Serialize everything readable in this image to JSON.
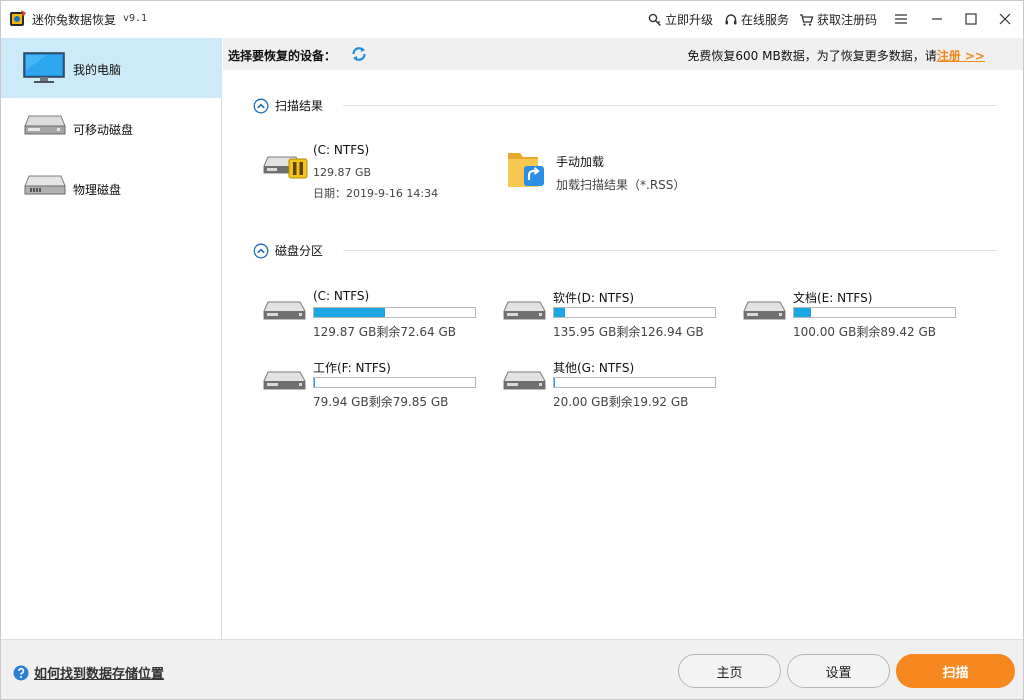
{
  "titlebar": {
    "title": "迷你兔数据恢复",
    "version": "v9.1",
    "links": {
      "upgrade": "立即升级",
      "online_service": "在线服务",
      "get_code": "获取注册码"
    }
  },
  "sidebar": {
    "items": [
      {
        "label": "我的电脑",
        "icon": "monitor-icon",
        "active": true
      },
      {
        "label": "可移动磁盘",
        "icon": "removable-disk-icon",
        "active": false
      },
      {
        "label": "物理磁盘",
        "icon": "physical-disk-icon",
        "active": false
      }
    ]
  },
  "header": {
    "select_label": "选择要恢复的设备：",
    "free_note": "免费恢复600 MB数据，为了恢复更多数据，请",
    "register_link": "注册 >>"
  },
  "scan_results": {
    "title": "扫描结果",
    "items": [
      {
        "name": "(C: NTFS)",
        "size": "129.87 GB",
        "date": "日期：2019-9-16 14:34"
      },
      {
        "name": "手动加载",
        "desc": "加载扫描结果（*.RSS）"
      }
    ]
  },
  "partitions": {
    "title": "磁盘分区",
    "items": [
      {
        "name": "(C: NTFS)",
        "usage": "129.87 GB剩余72.64 GB",
        "used_fraction": 0.44
      },
      {
        "name": "软件(D: NTFS)",
        "usage": "135.95 GB剩余126.94 GB",
        "used_fraction": 0.066
      },
      {
        "name": "文档(E: NTFS)",
        "usage": "100.00 GB剩余89.42 GB",
        "used_fraction": 0.106
      },
      {
        "name": "工作(F: NTFS)",
        "usage": "79.94 GB剩余79.85 GB",
        "used_fraction": 0.001
      },
      {
        "name": "其他(G: NTFS)",
        "usage": "20.00 GB剩余19.92 GB",
        "used_fraction": 0.004
      }
    ]
  },
  "footer": {
    "help": "如何找到数据存储位置",
    "home": "主页",
    "settings": "设置",
    "scan": "扫描"
  },
  "colors": {
    "accent": "#f7871f",
    "bar_fill": "#1ca6e3",
    "sidebar_active": "#cdeaf8",
    "link_orange": "#f08a1c"
  }
}
